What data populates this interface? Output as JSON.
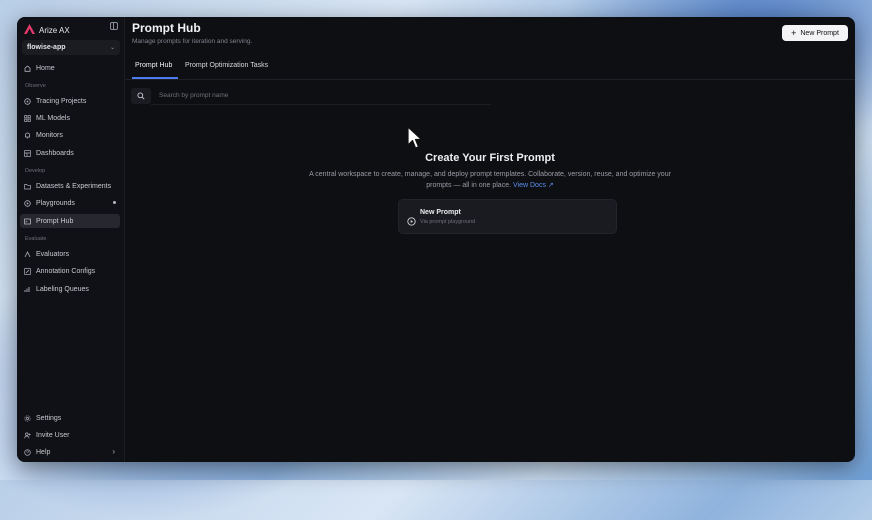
{
  "brand": {
    "name": "Arize AX"
  },
  "workspace": {
    "name": "flowise-app"
  },
  "sidebar": {
    "home": "Home",
    "sections": [
      "Observe",
      "Develop",
      "Evaluate"
    ],
    "observe": [
      "Tracing Projects",
      "ML Models",
      "Monitors",
      "Dashboards"
    ],
    "develop": [
      "Datasets & Experiments",
      "Playgrounds",
      "Prompt Hub"
    ],
    "evaluate": [
      "Evaluators",
      "Annotation Configs",
      "Labeling Queues"
    ],
    "bottom": [
      "Settings",
      "Invite User",
      "Help"
    ]
  },
  "header": {
    "title": "Prompt Hub",
    "subtitle": "Manage prompts for iteration and serving.",
    "new_button": "New Prompt"
  },
  "tabs": [
    "Prompt Hub",
    "Prompt Optimization Tasks"
  ],
  "search": {
    "placeholder": "Search by prompt name"
  },
  "empty_state": {
    "title": "Create Your First Prompt",
    "description": "A central workspace to create, manage, and deploy prompt templates. Collaborate, version, reuse, and optimize your prompts — all in one place.",
    "link": "View Docs"
  },
  "card": {
    "title": "New Prompt",
    "subtitle": "Via prompt playground"
  },
  "colors": {
    "accent": "#4b7bec",
    "link": "#5b8ff0",
    "brand": "#e5396b"
  }
}
